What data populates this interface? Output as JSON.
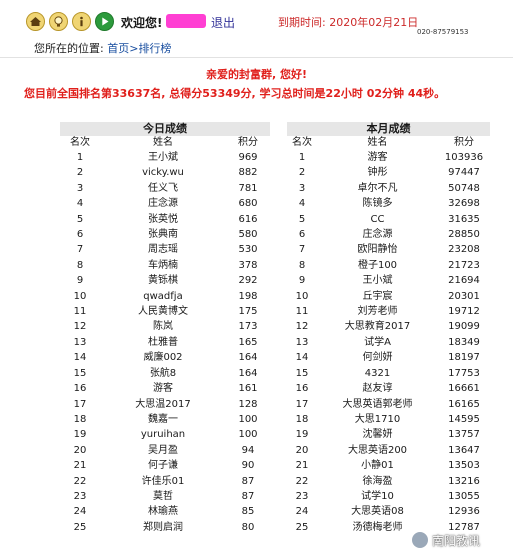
{
  "header": {
    "welcome": "欢迎您!",
    "logout": "退出",
    "expire": "到期时间: 2020年02月21日",
    "phone": "020-87579153",
    "icons": [
      "home-icon",
      "lightbulb-icon",
      "info-icon",
      "play-icon"
    ]
  },
  "breadcrumb": {
    "prefix": "您所在的位置:",
    "home": "首页",
    "sep": ">",
    "current": "排行榜"
  },
  "greeting": "亲爱的封富群, 您好!",
  "rank_summary": "您目前全国排名第33637名, 总得分53349分, 学习总时间是22小时 02分钟 44秒。",
  "today": {
    "title": "今日成绩",
    "headers": [
      "名次",
      "姓名",
      "积分"
    ],
    "rows": [
      [
        "1",
        "王小斌",
        "969"
      ],
      [
        "2",
        "vicky.wu",
        "882"
      ],
      [
        "3",
        "任义飞",
        "781"
      ],
      [
        "4",
        "庄念源",
        "680"
      ],
      [
        "5",
        "张英悦",
        "616"
      ],
      [
        "6",
        "张典南",
        "580"
      ],
      [
        "7",
        "周志瑶",
        "530"
      ],
      [
        "8",
        "车炳楠",
        "378"
      ],
      [
        "9",
        "黄铄棋",
        "292"
      ],
      [
        "10",
        "qwadfja",
        "198"
      ],
      [
        "11",
        "人民黄博文",
        "175"
      ],
      [
        "12",
        "陈岚",
        "173"
      ],
      [
        "13",
        "杜雅普",
        "165"
      ],
      [
        "14",
        "威廉002",
        "164"
      ],
      [
        "15",
        "张航8",
        "164"
      ],
      [
        "16",
        "游客",
        "161"
      ],
      [
        "17",
        "大思温2017",
        "128"
      ],
      [
        "18",
        "魏嘉一",
        "100"
      ],
      [
        "19",
        "yuruihan",
        "100"
      ],
      [
        "20",
        "吴月盈",
        "94"
      ],
      [
        "21",
        "何子谦",
        "90"
      ],
      [
        "22",
        "许佳乐01",
        "87"
      ],
      [
        "23",
        "莫哲",
        "87"
      ],
      [
        "24",
        "林瑜燕",
        "85"
      ],
      [
        "25",
        "郑则启润",
        "80"
      ]
    ]
  },
  "month": {
    "title": "本月成绩",
    "headers": [
      "名次",
      "姓名",
      "积分"
    ],
    "rows": [
      [
        "1",
        "游客",
        "103936"
      ],
      [
        "2",
        "钟彤",
        "97447"
      ],
      [
        "3",
        "卓尔不凡",
        "50748"
      ],
      [
        "4",
        "陈镜多",
        "32698"
      ],
      [
        "5",
        "CC",
        "31635"
      ],
      [
        "6",
        "庄念源",
        "28850"
      ],
      [
        "7",
        "欧阳静怡",
        "23208"
      ],
      [
        "8",
        "橙子100",
        "21723"
      ],
      [
        "9",
        "王小斌",
        "21694"
      ],
      [
        "10",
        "丘宇宸",
        "20301"
      ],
      [
        "11",
        "刘芳老师",
        "19712"
      ],
      [
        "12",
        "大思教育2017",
        "19099"
      ],
      [
        "13",
        "试学A",
        "18349"
      ],
      [
        "14",
        "何剑妍",
        "18197"
      ],
      [
        "15",
        "4321",
        "17753"
      ],
      [
        "16",
        "赵友谆",
        "16661"
      ],
      [
        "17",
        "大思英语郭老师",
        "16165"
      ],
      [
        "18",
        "大思1710",
        "14595"
      ],
      [
        "19",
        "沈馨妍",
        "13757"
      ],
      [
        "20",
        "大思英语200",
        "13647"
      ],
      [
        "21",
        "小静01",
        "13503"
      ],
      [
        "22",
        "徐海盈",
        "13216"
      ],
      [
        "23",
        "试学10",
        "13055"
      ],
      [
        "24",
        "大思英语08",
        "12936"
      ],
      [
        "25",
        "汤德梅老师",
        "12787"
      ]
    ]
  },
  "watermark": "南阳教讯"
}
